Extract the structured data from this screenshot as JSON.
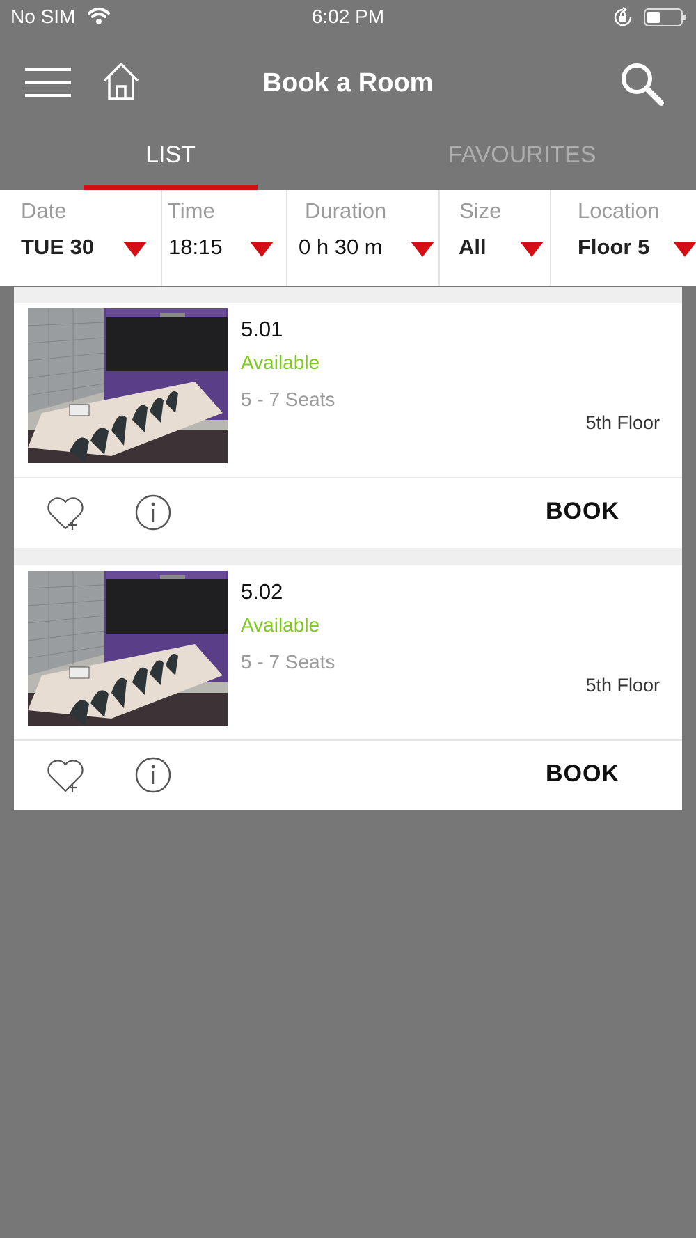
{
  "status_bar": {
    "carrier": "No SIM",
    "time": "6:02 PM",
    "icons": [
      "wifi-icon",
      "rotation-lock-icon",
      "battery-icon"
    ]
  },
  "header": {
    "title": "Book a Room",
    "icons": [
      "menu-icon",
      "home-icon",
      "search-icon"
    ]
  },
  "tabs": [
    {
      "label": "LIST",
      "active": true
    },
    {
      "label": "FAVOURITES",
      "active": false
    }
  ],
  "filters": {
    "date": {
      "label": "Date",
      "value": "TUE 30"
    },
    "time": {
      "label": "Time",
      "value": "18:15"
    },
    "duration": {
      "label": "Duration",
      "value": "0 h 30 m"
    },
    "size": {
      "label": "Size",
      "value": "All"
    },
    "location": {
      "label": "Location",
      "value": "Floor 5"
    }
  },
  "rooms": [
    {
      "name": "5.01",
      "status": "Available",
      "seats": "5 - 7 Seats",
      "floor": "5th Floor",
      "book_label": "BOOK"
    },
    {
      "name": "5.02",
      "status": "Available",
      "seats": "5 - 7 Seats",
      "floor": "5th Floor",
      "book_label": "BOOK"
    }
  ],
  "colors": {
    "accent": "#d40f14",
    "available": "#7fc91e",
    "chrome": "#777777"
  }
}
